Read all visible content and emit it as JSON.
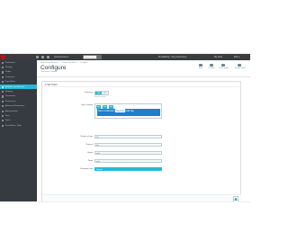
{
  "topbar": {
    "links": [
      "Quick Access ▾"
    ],
    "search_placeholder": "Search (e.g.: product reference, custo",
    "account_text": "PrestaShop · My preferences",
    "shop_link": "My shop",
    "user_link": "Bob ▾"
  },
  "sidebar": {
    "items": [
      {
        "label": "Dashboard",
        "active": false
      },
      {
        "label": "Catalog",
        "active": false
      },
      {
        "label": "Orders",
        "active": false
      },
      {
        "label": "Customers",
        "active": false
      },
      {
        "label": "Price Rules",
        "active": false
      },
      {
        "label": "Modules and Services",
        "active": true
      },
      {
        "label": "Shipping",
        "active": false
      },
      {
        "label": "Localization",
        "active": false
      },
      {
        "label": "Preferences",
        "active": false
      },
      {
        "label": "Advanced Parameters",
        "active": false
      },
      {
        "label": "Administration",
        "active": false
      },
      {
        "label": "Stats",
        "active": false
      },
      {
        "label": "Stock",
        "active": false
      },
      {
        "label": "PrestaShop · Help",
        "active": false
      }
    ]
  },
  "header": {
    "breadcrumb": [
      "Modules and Services",
      "/",
      "Custom Text Block",
      "/",
      "Configure"
    ],
    "title": "Configure",
    "subtitle": "Tags block / Module",
    "toolbar": [
      {
        "label": "Back",
        "icon": "back-icon"
      },
      {
        "label": "Translate",
        "icon": "flag-icon"
      },
      {
        "label": "Check update",
        "icon": "refresh-icon"
      },
      {
        "label": "Manage hooks",
        "icon": "hooks-icon"
      }
    ]
  },
  "panel": {
    "heading": "⚙ Settings",
    "fields": {
      "enabled": {
        "label": "Displaying",
        "yes": "YES",
        "no": "NO",
        "help": "Show the block"
      },
      "tags": {
        "label": "Tags to display",
        "tag1": "tag",
        "tag2": "tag",
        "tag3": "tag",
        "editing_prefix": "New Collection",
        "editing_selected": "Search",
        "editing_suffix": "Add tag"
      },
      "number": {
        "label": "Number of tags",
        "value": "10"
      },
      "random": {
        "label": "Random",
        "value": "No"
      },
      "height": {
        "label": "Height",
        "value": "auto"
      },
      "width": {
        "label": "Width",
        "value": "auto"
      },
      "navigation": {
        "label": "Navigation tags",
        "value": "Default"
      }
    },
    "save_label": "Save"
  }
}
